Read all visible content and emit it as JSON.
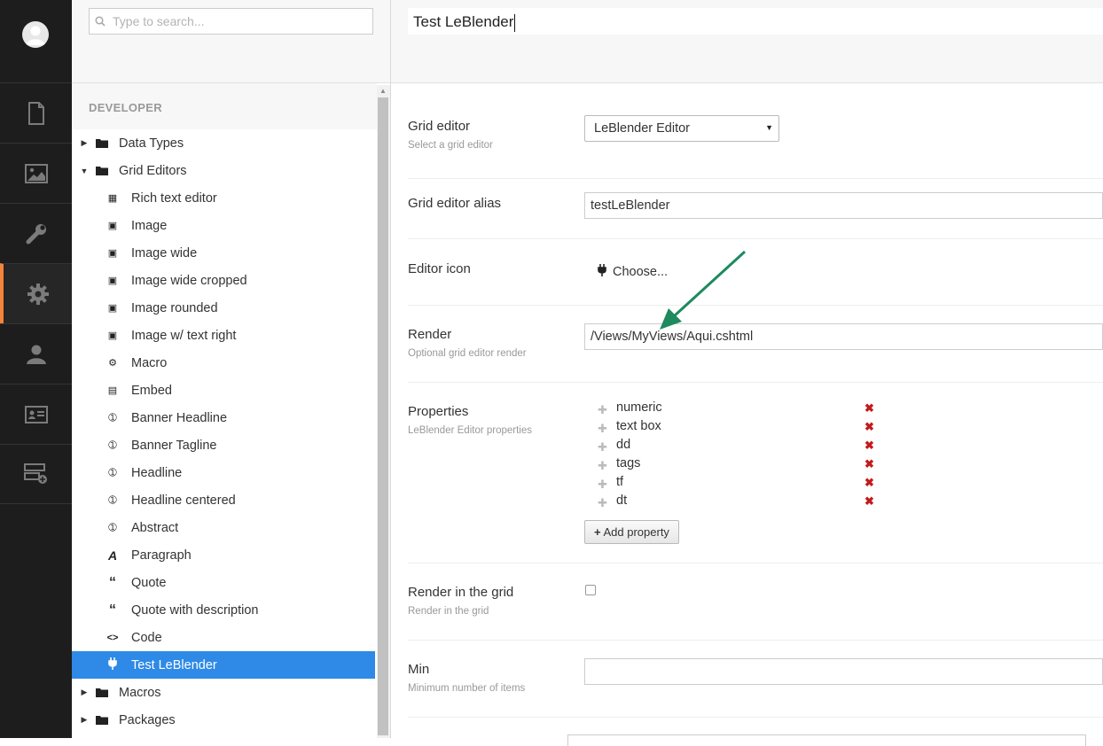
{
  "app_nav": {
    "sections": [
      {
        "icon": "document-icon",
        "active": false
      },
      {
        "icon": "media-icon",
        "active": false
      },
      {
        "icon": "wrench-icon",
        "active": false
      },
      {
        "icon": "gear-icon",
        "active": true
      },
      {
        "icon": "user-icon",
        "active": false
      },
      {
        "icon": "member-card-icon",
        "active": false
      },
      {
        "icon": "forms-icon",
        "active": false
      }
    ],
    "active_color": "#f5843a"
  },
  "search": {
    "placeholder": "Type to search..."
  },
  "tree": {
    "section_title": "DEVELOPER",
    "data_types": "Data Types",
    "grid_editors": "Grid Editors",
    "children": [
      {
        "label": "Rich text editor",
        "icon": "rte-icon"
      },
      {
        "label": "Image",
        "icon": "picture-icon"
      },
      {
        "label": "Image wide",
        "icon": "picture-icon"
      },
      {
        "label": "Image wide cropped",
        "icon": "picture-icon"
      },
      {
        "label": "Image rounded",
        "icon": "picture-icon"
      },
      {
        "label": "Image w/ text right",
        "icon": "picture-icon"
      },
      {
        "label": "Macro",
        "icon": "settings-alt-icon"
      },
      {
        "label": "Embed",
        "icon": "movie-icon"
      },
      {
        "label": "Banner Headline",
        "icon": "info-icon"
      },
      {
        "label": "Banner Tagline",
        "icon": "info-icon"
      },
      {
        "label": "Headline",
        "icon": "info-icon"
      },
      {
        "label": "Headline centered",
        "icon": "info-icon"
      },
      {
        "label": "Abstract",
        "icon": "info-icon"
      },
      {
        "label": "Paragraph",
        "icon": "font-icon"
      },
      {
        "label": "Quote",
        "icon": "quote-icon"
      },
      {
        "label": "Quote with description",
        "icon": "quote-icon"
      },
      {
        "label": "Code",
        "icon": "code-icon"
      },
      {
        "label": "Test LeBlender",
        "icon": "plug-icon",
        "selected": true
      }
    ],
    "macros": "Macros",
    "packages": "Packages",
    "selected_color": "#2e8ae6"
  },
  "editor": {
    "name": "Test LeBlender",
    "grid_editor": {
      "label": "Grid editor",
      "description": "Select a grid editor",
      "value": "LeBlender Editor"
    },
    "alias": {
      "label": "Grid editor alias",
      "value": "testLeBlender"
    },
    "icon": {
      "label": "Editor icon",
      "choose": "Choose..."
    },
    "render": {
      "label": "Render",
      "description": "Optional grid editor render",
      "value": "/Views/MyViews/Aqui.cshtml"
    },
    "properties": {
      "label": "Properties",
      "description": "LeBlender Editor properties",
      "items": [
        "numeric",
        "text box",
        "dd",
        "tags",
        "tf",
        "dt"
      ],
      "add_button": "Add property",
      "delete_color": "#c41a1a"
    },
    "render_in_grid": {
      "label": "Render in the grid",
      "description": "Render in the grid",
      "checked": false
    },
    "min": {
      "label": "Min",
      "description": "Minimum number of items",
      "value": ""
    }
  },
  "annotation_arrow": {
    "color": "#1e8a5e"
  }
}
